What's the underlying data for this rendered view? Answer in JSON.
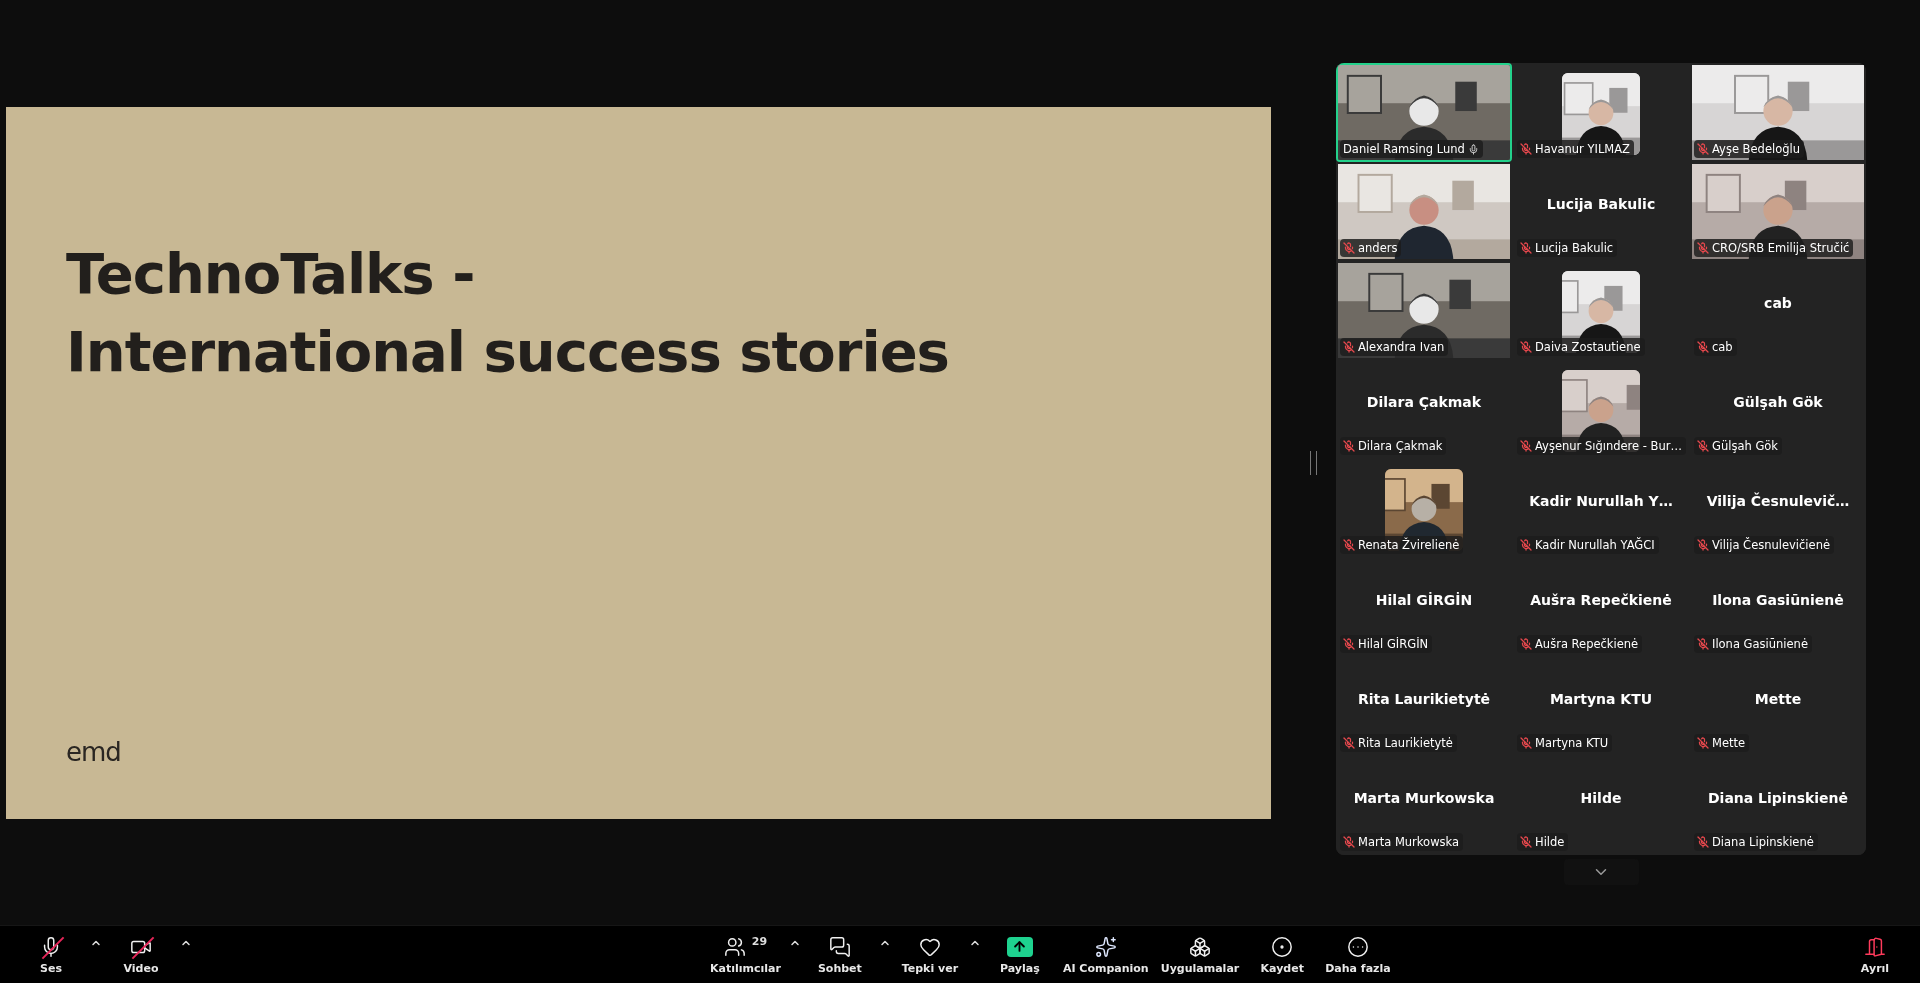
{
  "slide": {
    "title_lines": [
      "TechnoTalks -",
      "International success stories"
    ],
    "logo": "emd"
  },
  "participants": [
    {
      "name": "Daniel Ramsing Lund",
      "kind": "video",
      "muted": false,
      "speaking": true
    },
    {
      "name": "Havanur YILMAZ",
      "kind": "avatar",
      "muted": true,
      "speaking": false
    },
    {
      "name": "Ayşe Bedeloğlu",
      "kind": "video",
      "muted": true,
      "speaking": false
    },
    {
      "name": "anders",
      "kind": "video",
      "muted": true,
      "speaking": false
    },
    {
      "name": "Lucija Bakulic",
      "kind": "name",
      "display_name": "Lucija Bakulic",
      "muted": true,
      "speaking": false
    },
    {
      "name": "CRO/SRB Emilija Stručić",
      "kind": "video",
      "muted": true,
      "speaking": false
    },
    {
      "name": "Alexandra Ivan",
      "kind": "video",
      "muted": true,
      "speaking": false
    },
    {
      "name": "Daiva Zostautiene",
      "kind": "avatar",
      "muted": true,
      "speaking": false
    },
    {
      "name": "cab",
      "kind": "name",
      "display_name": "cab",
      "muted": true,
      "speaking": false
    },
    {
      "name": "Dilara Çakmak",
      "kind": "name",
      "display_name": "Dilara Çakmak",
      "muted": true,
      "speaking": false
    },
    {
      "name": "Ayşenur Sığındere - Bur…",
      "kind": "avatar",
      "muted": true,
      "speaking": false
    },
    {
      "name": "Gülşah Gök",
      "kind": "name",
      "display_name": "Gülşah Gök",
      "muted": true,
      "speaking": false
    },
    {
      "name": "Renata Žvirelienė",
      "kind": "avatar",
      "muted": true,
      "speaking": false
    },
    {
      "name": "Kadir Nurullah YAĞCI",
      "kind": "name",
      "display_name": "Kadir Nurullah Y…",
      "muted": true,
      "speaking": false
    },
    {
      "name": "Vilija Česnulevičienė",
      "kind": "name",
      "display_name": "Vilija Česnulevič…",
      "muted": true,
      "speaking": false
    },
    {
      "name": "Hilal GİRGİN",
      "kind": "name",
      "display_name": "Hilal GİRGİN",
      "muted": true,
      "speaking": false
    },
    {
      "name": "Aušra Repečkienė",
      "kind": "name",
      "display_name": "Aušra Repečkienė",
      "muted": true,
      "speaking": false
    },
    {
      "name": "Ilona Gasiūnienė",
      "kind": "name",
      "display_name": "Ilona Gasiūnienė",
      "muted": true,
      "speaking": false
    },
    {
      "name": "Rita Laurikietytė",
      "kind": "name",
      "display_name": "Rita Laurikietytė",
      "muted": true,
      "speaking": false
    },
    {
      "name": "Martyna KTU",
      "kind": "name",
      "display_name": "Martyna KTU",
      "muted": true,
      "speaking": false
    },
    {
      "name": "Mette",
      "kind": "name",
      "display_name": "Mette",
      "muted": true,
      "speaking": false
    },
    {
      "name": "Marta Murkowska",
      "kind": "name",
      "display_name": "Marta Murkowska",
      "muted": true,
      "speaking": false
    },
    {
      "name": "Hilde",
      "kind": "name",
      "display_name": "Hilde",
      "muted": true,
      "speaking": false
    },
    {
      "name": "Diana Lipinskienė",
      "kind": "name",
      "display_name": "Diana Lipinskienė",
      "muted": true,
      "speaking": false
    }
  ],
  "toolbar": {
    "left": [
      {
        "label": "Ses",
        "kind": "mic",
        "crossed": true,
        "caret": true
      },
      {
        "label": "Video",
        "kind": "video",
        "crossed": true,
        "caret": true
      }
    ],
    "center": [
      {
        "label": "Katılımcılar",
        "kind": "people",
        "count": "29",
        "crossed": false,
        "caret": true
      },
      {
        "label": "Sohbet",
        "kind": "chat",
        "crossed": false,
        "caret": true
      },
      {
        "label": "Tepki ver",
        "kind": "heart",
        "crossed": false,
        "caret": true
      },
      {
        "label": "Paylaş",
        "kind": "share",
        "crossed": false,
        "caret": false
      },
      {
        "label": "AI Companion",
        "kind": "sparkle",
        "crossed": false,
        "caret": false
      },
      {
        "label": "Uygulamalar",
        "kind": "apps",
        "crossed": false,
        "caret": false
      },
      {
        "label": "Kaydet",
        "kind": "record",
        "crossed": false,
        "caret": false
      },
      {
        "label": "Daha fazla",
        "kind": "more",
        "crossed": false,
        "caret": false
      }
    ],
    "right": [
      {
        "label": "Ayrıl",
        "kind": "leave",
        "crossed": false,
        "caret": false
      }
    ]
  }
}
